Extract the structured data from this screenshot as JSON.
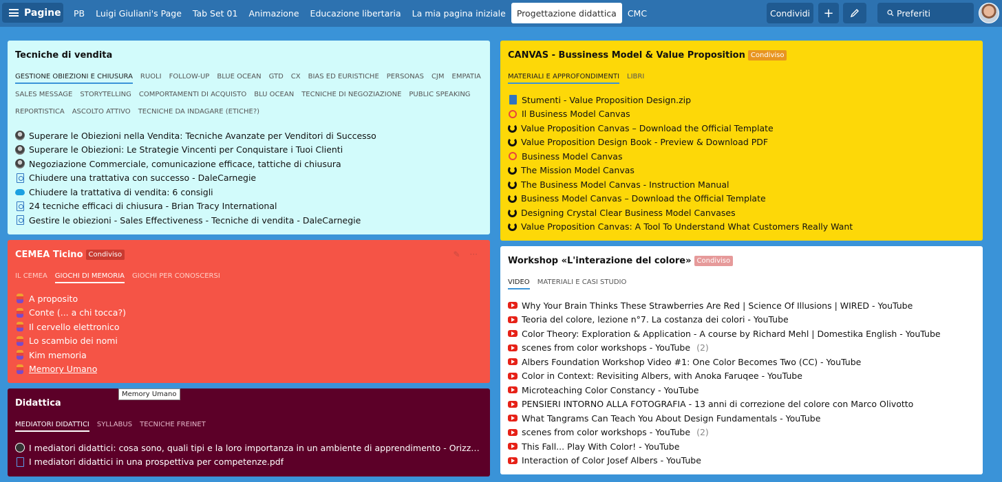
{
  "topbar": {
    "pages_label": "Pagine",
    "tabs": [
      "PB",
      "Luigi Giuliani's Page",
      "Tab Set 01",
      "Animazione",
      "Educazione libertaria",
      "La mia pagina iniziale",
      "Progettazione didattica",
      "CMC"
    ],
    "active_tab": "Progettazione didattica",
    "share_label": "Condividi",
    "add_label": "+",
    "search_placeholder": "Preferiti"
  },
  "widgets": {
    "vendita": {
      "title": "Tecniche di vendita",
      "tabs_row1": [
        "Gestione obiezioni e chiusura",
        "Ruoli",
        "Follow-up",
        "Blue Ocean",
        "GTD",
        "CX",
        "Bias ed euristiche",
        "Personas",
        "CJM",
        "Empatia"
      ],
      "tabs_row2": [
        "Sales message",
        "Storytelling",
        "Comportamenti di acquisto",
        "Blu ocean",
        "Tecniche di negoziazione",
        "Public speaking"
      ],
      "tabs_row3": [
        "Reportistica",
        "Ascolto attivo",
        "Tecniche da indagare (etiche?)"
      ],
      "links": [
        {
          "icon": "avatar-icon",
          "text": "Superare le Obiezioni nella Vendita: Tecniche Avanzate per Venditori di Successo"
        },
        {
          "icon": "avatar-icon",
          "text": "Superare le Obiezioni: Le Strategie Vincenti per Conquistare i Tuoi Clienti"
        },
        {
          "icon": "avatar-icon",
          "text": "Negoziazione Commerciale, comunicazione efficace, tattiche di chiusura"
        },
        {
          "icon": "pdf-icon",
          "text": "Chiudere una trattativa con successo - DaleCarnegie"
        },
        {
          "icon": "cloud-icon",
          "text": "Chiudere la trattativa di vendita: 6 consigli"
        },
        {
          "icon": "pdf-icon",
          "text": "24 tecniche efficaci di chiusura - Brian Tracy International"
        },
        {
          "icon": "pdf-icon",
          "text": "Gestire le obiezioni - Sales Effectiveness - Tecniche di vendita - DaleCarnegie"
        }
      ]
    },
    "cemea": {
      "title": "CEMEA Ticino",
      "badge": "Condiviso",
      "tabs": [
        "Il CEMEA",
        "Giochi di memoria",
        "Giochi per conoscersi"
      ],
      "links": [
        {
          "text": "A proposito"
        },
        {
          "text": "Conte (... a chi tocca?)"
        },
        {
          "text": "Il cervello elettronico"
        },
        {
          "text": "Lo scambio dei nomi"
        },
        {
          "text": "Kim memoria"
        },
        {
          "text": "Memory Umano"
        }
      ],
      "tooltip": "Memory Umano"
    },
    "didattica": {
      "title": "Didattica",
      "tabs": [
        "Mediatori didattici",
        "Syllabus",
        "Tecniche Freinet"
      ],
      "links": [
        {
          "icon": "orizzonte-icon",
          "text": "I mediatori didattici: cosa sono, quali tipi e la loro importanza in un ambiente di apprendimento - Orizzonte Scuola Notizie"
        },
        {
          "icon": "pdf-icon",
          "text": "I mediatori didattici in una prospettiva per competenze.pdf"
        }
      ]
    },
    "canvas": {
      "title": "CANVAS - Bussiness Model & Value Proposition",
      "badge": "Condiviso",
      "tabs": [
        "Materiali e approfondimenti",
        "Libri"
      ],
      "links": [
        {
          "icon": "doc-icon",
          "text": "Stumenti - Value Proposition Design.zip"
        },
        {
          "icon": "ring-icon",
          "text": "Il Business Model Canvas"
        },
        {
          "icon": "swirl-icon",
          "text": "Value Proposition Canvas – Download the Official Template"
        },
        {
          "icon": "swirl-icon",
          "text": "Value Proposition Design Book - Preview & Download PDF"
        },
        {
          "icon": "ring-icon",
          "text": "Business Model Canvas"
        },
        {
          "icon": "swirl-icon",
          "text": "The Mission Model Canvas"
        },
        {
          "icon": "swirl-icon",
          "text": "The Business Model Canvas - Instruction Manual"
        },
        {
          "icon": "swirl-icon",
          "text": "Business Model Canvas – Download the Official Template"
        },
        {
          "icon": "swirl-icon",
          "text": "Designing Crystal Clear Business Model Canvases"
        },
        {
          "icon": "swirl-icon",
          "text": "Value Proposition Canvas: A Tool To Understand What Customers Really Want"
        }
      ]
    },
    "workshop": {
      "title": "Workshop «L'interazione del colore»",
      "badge": "Condiviso",
      "tabs": [
        "Video",
        "Materiali e casi studio"
      ],
      "links": [
        {
          "text": "Why Your Brain Thinks These Strawberries Are Red | Science Of Illusions | WIRED - YouTube",
          "count": ""
        },
        {
          "text": "Teoria del colore, lezione n°7. La costanza dei colori - YouTube",
          "count": ""
        },
        {
          "text": "Color Theory: Exploration & Application - A course by Richard Mehl | Domestika English - YouTube",
          "count": ""
        },
        {
          "text": "scenes from color workshops - YouTube",
          "count": "(2)"
        },
        {
          "text": "Albers Foundation Workshop Video #1: One Color Becomes Two (CC) - YouTube",
          "count": ""
        },
        {
          "text": "Color in Context: Revisiting Albers, with Anoka Faruqee - YouTube",
          "count": ""
        },
        {
          "text": "Microteaching Color Constancy - YouTube",
          "count": ""
        },
        {
          "text": "PENSIERI INTORNO ALLA FOTOGRAFIA - 13 anni di correzione del colore con Marco Olivotto",
          "count": ""
        },
        {
          "text": "What Tangrams Can Teach You About Design Fundamentals - YouTube",
          "count": ""
        },
        {
          "text": "scenes from color workshops - YouTube",
          "count": "(2)"
        },
        {
          "text": "This Fall... Play With Color! - YouTube",
          "count": ""
        },
        {
          "text": "Interaction of Color Josef Albers - YouTube",
          "count": ""
        }
      ]
    }
  },
  "colors": {
    "background": "#3a93d8",
    "topbar": "#2d72b0",
    "vendita_bg": "#d2fbfb",
    "cemea_bg": "#f55446",
    "didattica_bg": "#5c0028",
    "canvas_bg": "#fdd808",
    "workshop_bg": "#ffffff",
    "tab_underline": "#3a93d8"
  }
}
